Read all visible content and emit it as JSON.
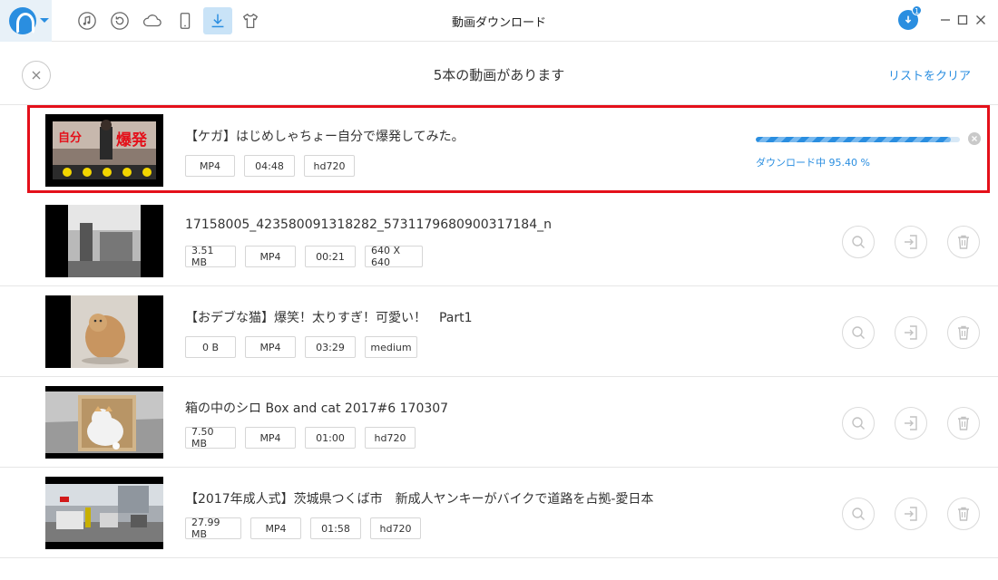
{
  "window": {
    "title": "動画ダウンロード",
    "download_badge": "1"
  },
  "toolbar": {
    "icons": [
      "app-logo-icon",
      "music-icon",
      "restore-icon",
      "cloud-icon",
      "phone-icon",
      "download-icon",
      "tshirt-icon"
    ],
    "active": "download-icon"
  },
  "header": {
    "title": "5本の動画があります",
    "clear_label": "リストをクリア"
  },
  "colors": {
    "accent": "#2a8ee0",
    "highlight_border": "#e4101a",
    "divider": "#e6e6e6"
  },
  "downloading": {
    "title": "【ケガ】はじめしゃちょー自分で爆発してみた。",
    "tags": [
      "MP4",
      "04:48",
      "hd720"
    ],
    "progress_fraction": 0.954,
    "status_text": "ダウンロード中 95.40 %"
  },
  "items": [
    {
      "title": "17158005_423580091318282_5731179680900317184_n",
      "tags": [
        "3.51 MB",
        "MP4",
        "00:21",
        "640 X 640"
      ]
    },
    {
      "title": "【おデブな猫】爆笑！太りすぎ！可愛い！　Part1",
      "tags": [
        "0 B",
        "MP4",
        "03:29",
        "medium"
      ]
    },
    {
      "title": "箱の中のシロ Box and cat 2017#6 170307",
      "tags": [
        "7.50 MB",
        "MP4",
        "01:00",
        "hd720"
      ]
    },
    {
      "title": "【2017年成人式】茨城県つくば市　新成人ヤンキーがバイクで道路を占拠-愛日本",
      "tags": [
        "27.99 MB",
        "MP4",
        "01:58",
        "hd720"
      ]
    }
  ]
}
